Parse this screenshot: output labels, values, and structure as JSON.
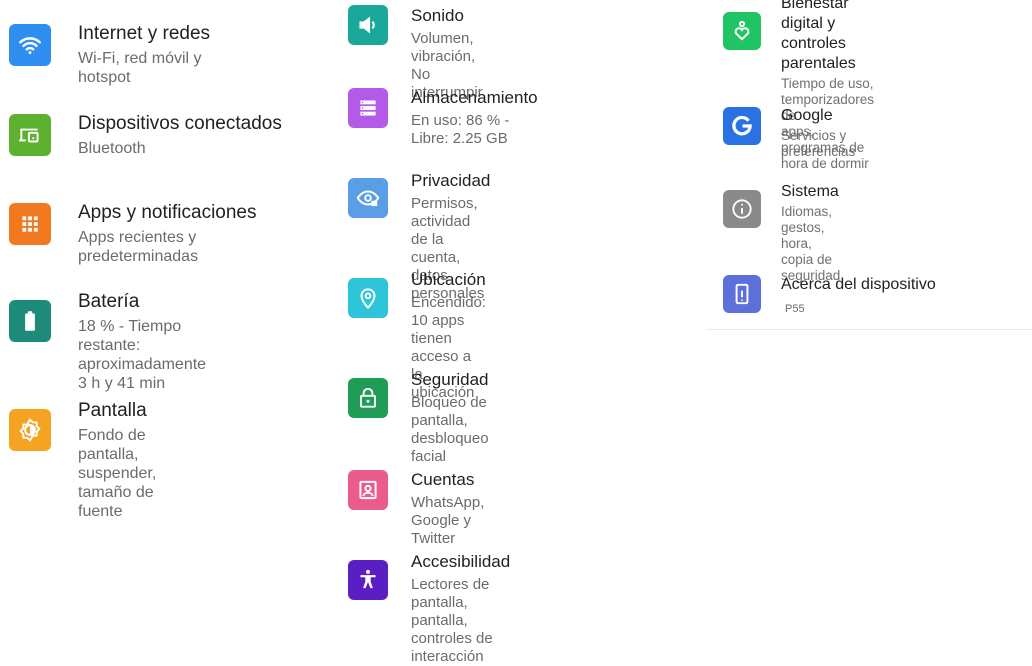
{
  "colors": {
    "network": "#2f8ff0",
    "connected": "#5db12e",
    "apps": "#f27a1e",
    "battery": "#1d8a7a",
    "display": "#f5a320",
    "sound": "#1aa89b",
    "storage": "#b35ae6",
    "privacy": "#5a9ee8",
    "location": "#2ec4d9",
    "security": "#1f9c55",
    "accounts": "#ec5b8e",
    "accessibility": "#5a1ec2",
    "wellbeing": "#20c463",
    "google": "#2a72e3",
    "system": "#8a8a8a",
    "about": "#5d6fd9"
  },
  "column1": [
    {
      "title": "Internet y redes",
      "subtitle": "Wi-Fi, red móvil y hotspot",
      "icon": "wifi-icon"
    },
    {
      "title": "Dispositivos conectados",
      "subtitle": "Bluetooth",
      "icon": "connected-devices-icon"
    },
    {
      "title": "Apps y notificaciones",
      "subtitle": "Apps recientes y predeterminadas",
      "icon": "apps-grid-icon"
    },
    {
      "title": "Batería",
      "subtitle": "18 % - Tiempo restante:\naproximadamente 3 h y 41 min",
      "icon": "battery-icon"
    },
    {
      "title": "Pantalla",
      "subtitle": "Fondo de pantalla, suspender,\ntamaño de fuente",
      "icon": "brightness-icon"
    }
  ],
  "column2": [
    {
      "title": "Sonido",
      "subtitle": "Volumen, vibración, No interrumpir",
      "icon": "volume-icon"
    },
    {
      "title": "Almacenamiento",
      "subtitle": "En uso: 86 % - Libre: 2.25 GB",
      "icon": "storage-icon"
    },
    {
      "title": "Privacidad",
      "subtitle": "Permisos, actividad de la cuenta,\ndatos personales",
      "icon": "privacy-eye-icon"
    },
    {
      "title": "Ubicación",
      "subtitle": "Encendido: 10 apps tienen acceso a\nla ubicación",
      "icon": "location-pin-icon"
    },
    {
      "title": "Seguridad",
      "subtitle": "Bloqueo de pantalla, desbloqueo\nfacial",
      "icon": "lock-icon"
    },
    {
      "title": "Cuentas",
      "subtitle": "WhatsApp, Google y Twitter",
      "icon": "account-icon"
    },
    {
      "title": "Accesibilidad",
      "subtitle": "Lectores de pantalla, pantalla,\ncontroles de interacción",
      "icon": "accessibility-icon"
    }
  ],
  "column3": [
    {
      "title": "Bienestar digital y controles\nparentales",
      "subtitle": "Tiempo de uso, temporizadores de\napps, programas de hora de dormir",
      "icon": "wellbeing-icon"
    },
    {
      "title": "Google",
      "subtitle": "Servicios y preferencias",
      "icon": "google-icon"
    },
    {
      "title": "Sistema",
      "subtitle": "Idiomas, gestos, hora, copia de\nseguridad",
      "icon": "info-icon"
    },
    {
      "title": "Acerca del dispositivo",
      "subtitle": "",
      "device_model": "P55",
      "icon": "phone-icon"
    }
  ]
}
